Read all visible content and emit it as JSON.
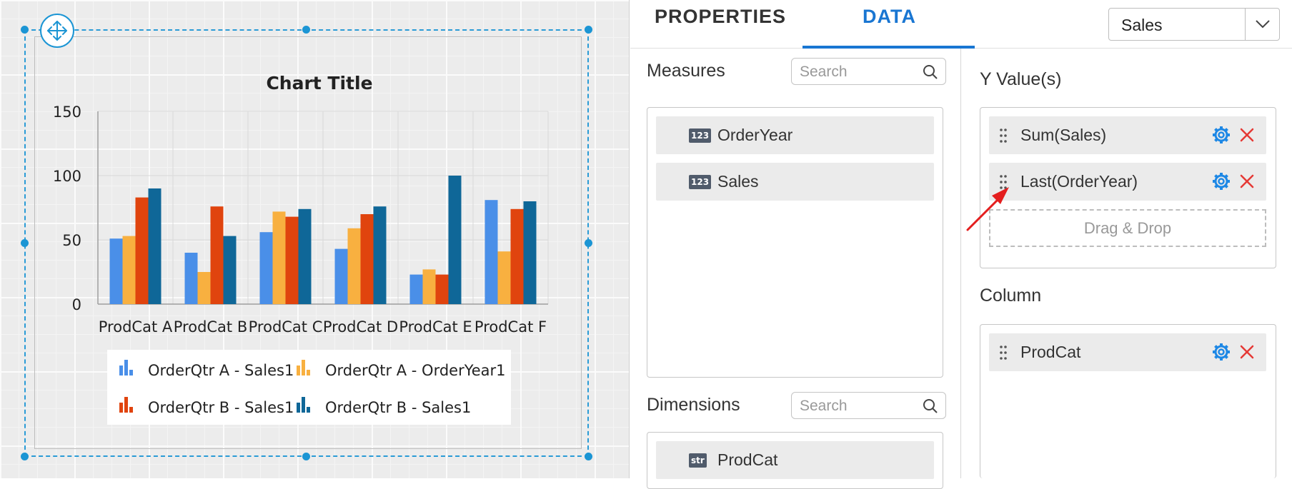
{
  "canvas": {
    "chart": {
      "title": "Chart Title"
    }
  },
  "chart_data": {
    "type": "bar",
    "title": "Chart Title",
    "categories": [
      "ProdCat A",
      "ProdCat B",
      "ProdCat C",
      "ProdCat D",
      "ProdCat E",
      "ProdCat F"
    ],
    "y_ticks": [
      "0",
      "50",
      "100",
      "150"
    ],
    "ylim": [
      0,
      150
    ],
    "grid": true,
    "legend_position": "bottom",
    "series": [
      {
        "name": "OrderQtr A - Sales1",
        "color": "#4a8fe8",
        "values": [
          51,
          40,
          56,
          43,
          23,
          81
        ]
      },
      {
        "name": "OrderQtr A - OrderYear1",
        "color": "#f8b040",
        "values": [
          53,
          25,
          72,
          59,
          27,
          41
        ]
      },
      {
        "name": "OrderQtr B - Sales1",
        "color": "#e0440e",
        "values": [
          83,
          76,
          68,
          70,
          23,
          74
        ]
      },
      {
        "name": "OrderQtr B - Sales1",
        "color": "#0f6798",
        "values": [
          90,
          53,
          74,
          76,
          100,
          80
        ]
      }
    ]
  },
  "panel": {
    "tabs": {
      "properties": "PROPERTIES",
      "data": "DATA"
    },
    "datasource": {
      "value": "Sales"
    },
    "measures": {
      "title": "Measures",
      "search_placeholder": "Search",
      "items": [
        {
          "badge": "123",
          "label": "OrderYear"
        },
        {
          "badge": "123",
          "label": "Sales"
        }
      ]
    },
    "dimensions": {
      "title": "Dimensions",
      "search_placeholder": "Search",
      "items": [
        {
          "badge": "str",
          "label": "ProdCat"
        }
      ]
    },
    "y_values": {
      "title": "Y Value(s)",
      "items": [
        {
          "label": "Sum(Sales)"
        },
        {
          "label": "Last(OrderYear)"
        }
      ],
      "dropzone": "Drag & Drop"
    },
    "column": {
      "title": "Column",
      "items": [
        {
          "label": "ProdCat"
        }
      ]
    }
  },
  "colors": {
    "accent": "#1976d2",
    "selection": "#1b95d4",
    "delete": "#e53935"
  }
}
